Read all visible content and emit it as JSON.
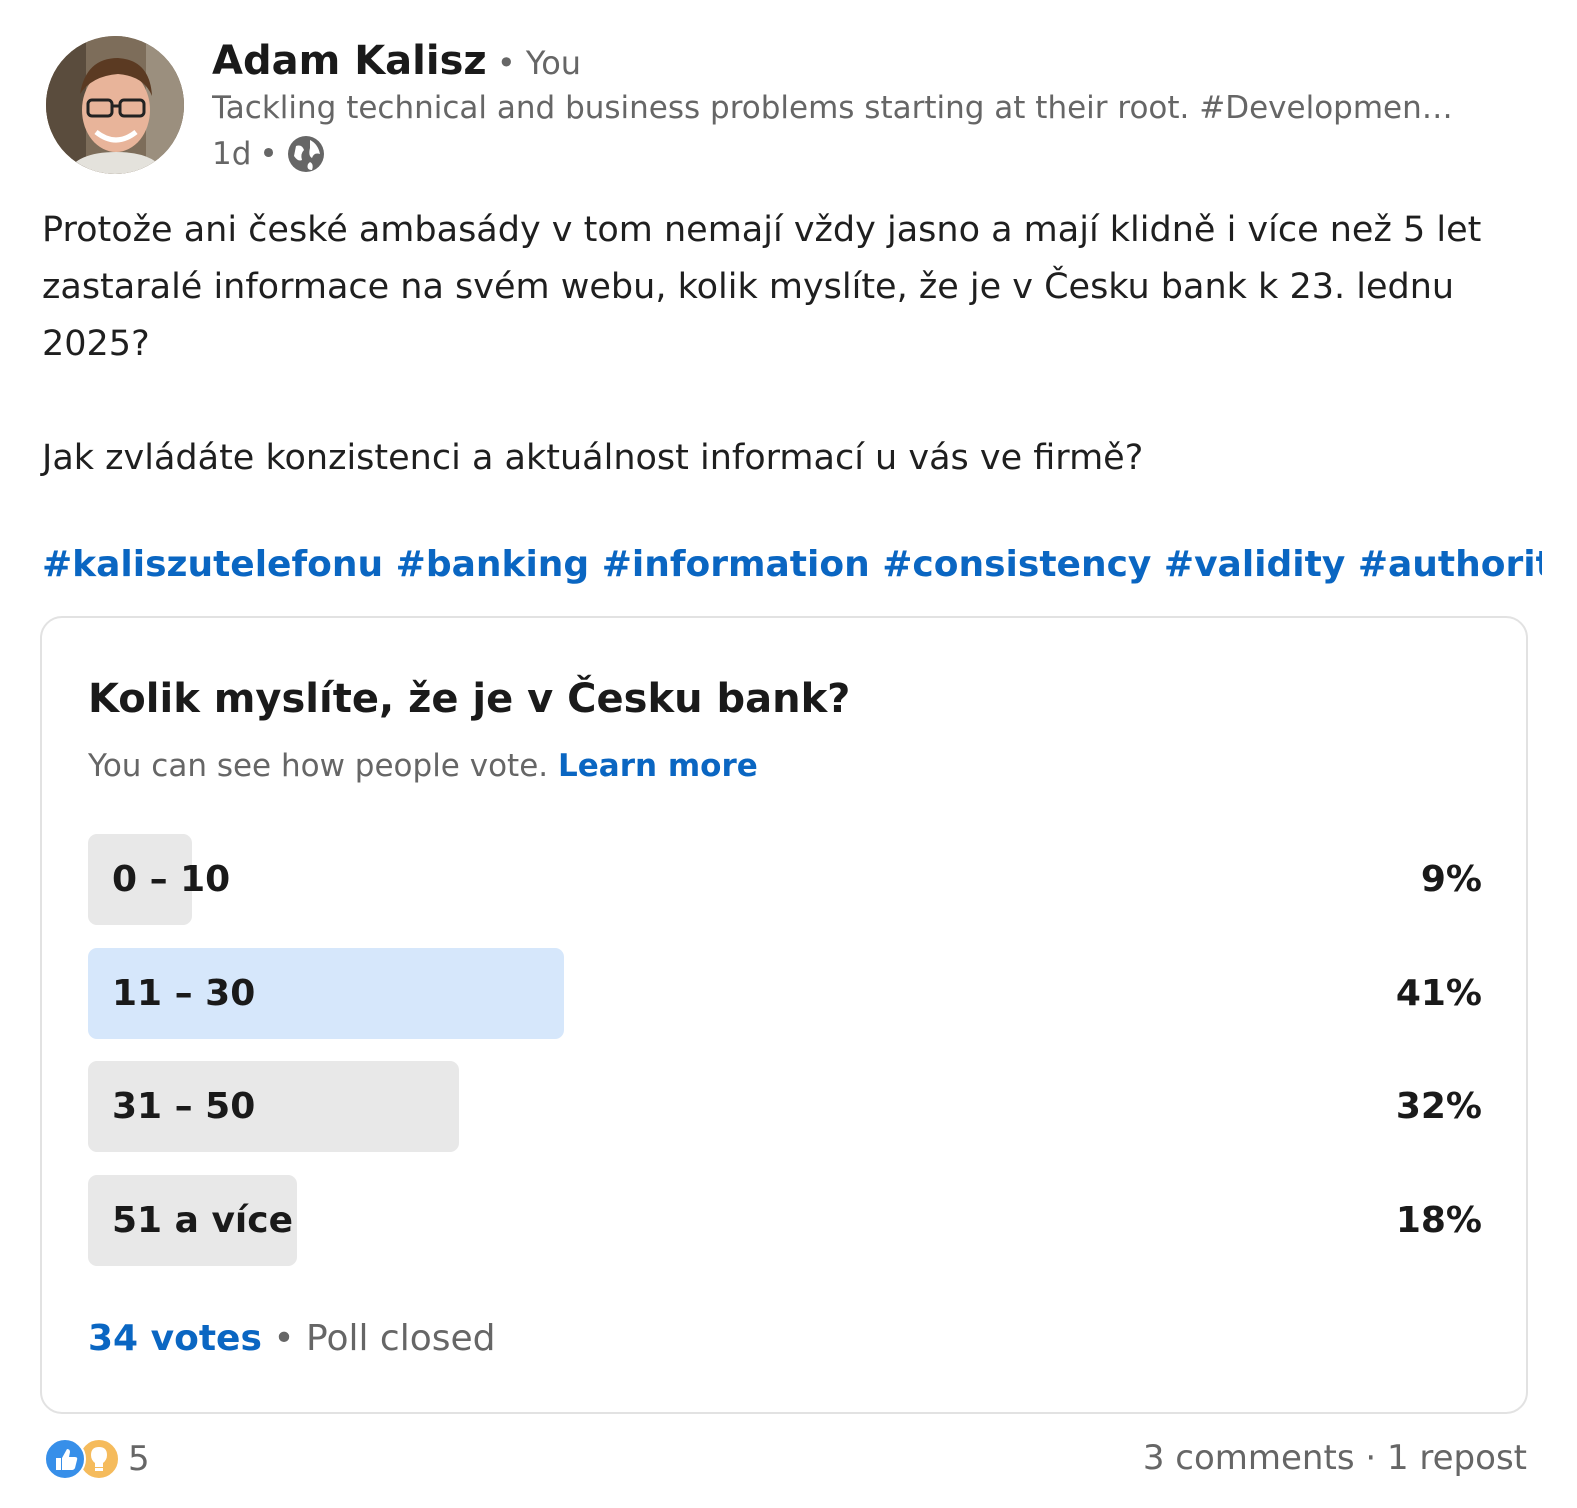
{
  "author": {
    "name": "Adam Kalisz",
    "relation": "You",
    "headline": "Tackling technical and business problems starting at their root. #Development #…",
    "time": "1d",
    "visibility_icon": "globe-icon"
  },
  "post": {
    "paragraph1": "Protože ani české ambasády v tom nemají vždy jasno a mají klidně i více než 5 let zastaralé informace na svém webu, kolik myslíte, že je v Česku bank k 23. lednu 2025?",
    "paragraph2": "Jak zvládáte konzistenci a aktuálnost informací u vás ve firmě?",
    "hashtags": "#kaliszutelefonu #banking #information #consistency #validity #authority #auth"
  },
  "poll": {
    "question": "Kolik myslíte, že je v Česku bank?",
    "note": "You can see how people vote.",
    "note_link": "Learn more",
    "options": [
      {
        "label": "0 – 10",
        "percent": "9%",
        "value": 9,
        "selected": false
      },
      {
        "label": "11 – 30",
        "percent": "41%",
        "value": 41,
        "selected": true
      },
      {
        "label": "31 – 50",
        "percent": "32%",
        "value": 32,
        "selected": false
      },
      {
        "label": "51 a více",
        "percent": "18%",
        "value": 18,
        "selected": false
      }
    ],
    "votes": "34 votes",
    "status": "Poll closed"
  },
  "social": {
    "reaction_icons": [
      "like-icon",
      "insightful-icon"
    ],
    "reaction_count": "5",
    "comments": "3 comments",
    "reposts": "1 repost"
  },
  "colors": {
    "link": "#0a66c2",
    "selected_bar": "#d6e7fb",
    "bar": "#e8e8e8"
  }
}
